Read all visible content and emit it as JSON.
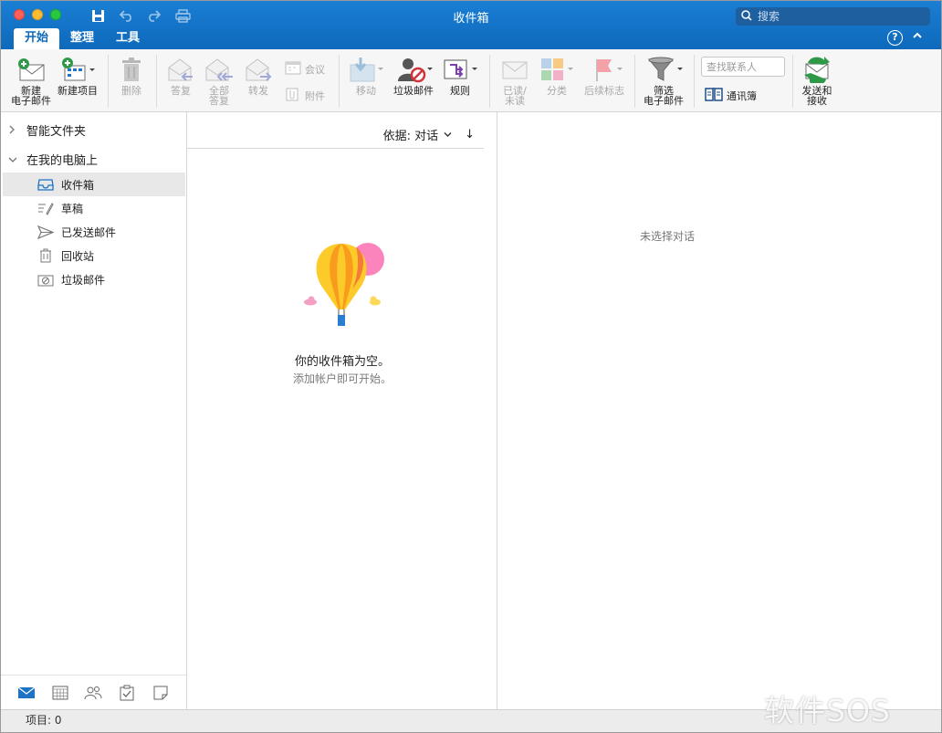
{
  "window": {
    "title": "收件箱"
  },
  "search": {
    "placeholder": "搜索"
  },
  "ribbon_tabs": [
    "开始",
    "整理",
    "工具"
  ],
  "help_label": "?",
  "ribbon": {
    "new_email": "新建\n电子邮件",
    "new_item": "新建项目",
    "delete": "删除",
    "reply": "答复",
    "reply_all": "全部\n答复",
    "forward": "转发",
    "meeting": "会议",
    "attachment": "附件",
    "move": "移动",
    "junk": "垃圾邮件",
    "rules": "规则",
    "read_unread": "已读/\n未读",
    "categorize": "分类",
    "follow_up": "后续标志",
    "filter_email": "筛选\n电子邮件",
    "contact_search_placeholder": "查找联系人",
    "address_book": "通讯簿",
    "send_receive": "发送和\n接收"
  },
  "sidebar": {
    "smart_folders": "智能文件夹",
    "on_my_computer": "在我的电脑上",
    "folders": [
      {
        "label": "收件箱",
        "icon": "inbox-icon",
        "selected": true
      },
      {
        "label": "草稿",
        "icon": "drafts-icon"
      },
      {
        "label": "已发送邮件",
        "icon": "sent-icon"
      },
      {
        "label": "回收站",
        "icon": "trash-icon"
      },
      {
        "label": "垃圾邮件",
        "icon": "junk-icon"
      }
    ],
    "nav_icons": [
      "mail-icon",
      "calendar-icon",
      "people-icon",
      "tasks-icon",
      "notes-icon"
    ]
  },
  "message_list": {
    "sort_label": "依据: 对话",
    "sort_direction": "↓",
    "empty_title": "你的收件箱为空。",
    "empty_subtitle": "添加帐户即可开始。"
  },
  "reading_pane": {
    "no_selection": "未选择对话"
  },
  "status_bar": {
    "items": "项目: 0"
  },
  "watermark": "软件SOS",
  "colors": {
    "titlebar": "#0e69bb",
    "accent": "#0e69bb",
    "selected": "#e8e8e8"
  }
}
